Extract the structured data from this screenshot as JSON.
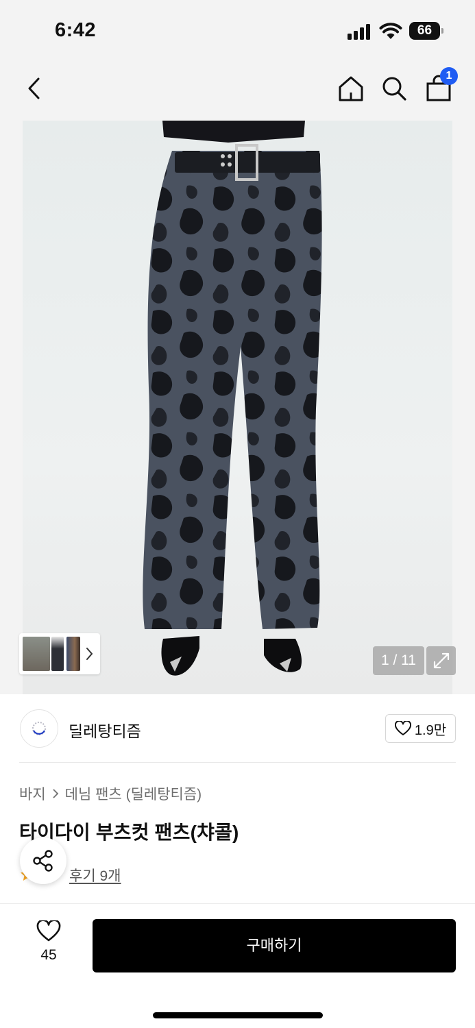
{
  "status_bar": {
    "time": "6:42",
    "battery": "66"
  },
  "nav": {
    "cart_count": "1"
  },
  "gallery": {
    "counter": "1 / 11"
  },
  "brand": {
    "name": "딜레탕티즘",
    "likes": "1.9만"
  },
  "breadcrumb": {
    "category": "바지",
    "subcategory": "데님 팬츠 (딜레탕티즘)"
  },
  "product": {
    "title": "타이다이 부츠컷 팬츠(챠콜)",
    "rating": "5",
    "review_link": "후기 9개"
  },
  "bottom_bar": {
    "wish_count": "45",
    "buy_label": "구매하기"
  },
  "colors": {
    "accent": "#1f5cf3",
    "buy_button": "#000000",
    "star": "#f5a623"
  },
  "icons": [
    "back-icon",
    "home-icon",
    "search-icon",
    "shopping-bag-icon",
    "chevron-right-icon",
    "expand-icon",
    "heart-icon",
    "share-icon",
    "star-icon"
  ]
}
